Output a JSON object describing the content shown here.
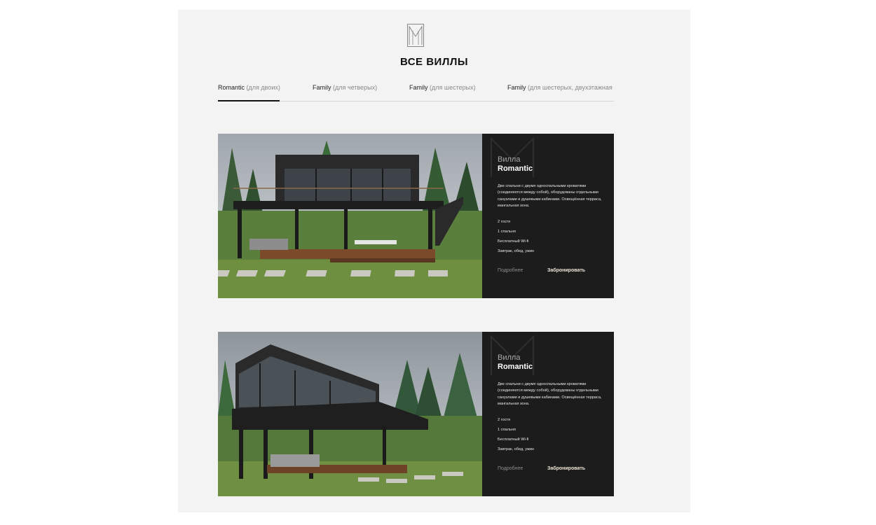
{
  "page_title": "ВСЕ ВИЛЛЫ",
  "logo": {
    "icon": "villa-logo-icon"
  },
  "tabs": [
    {
      "label": "Romantic",
      "sub": "(для двоих)",
      "active": true
    },
    {
      "label": "Family",
      "sub": "(для четверых)",
      "active": false
    },
    {
      "label": "Family",
      "sub": "(для шестерых)",
      "active": false
    },
    {
      "label": "Family",
      "sub": "(для шестерых, двухэтажная",
      "active": false
    }
  ],
  "cards": [
    {
      "villa_label": "Вилла",
      "name": "Romantic",
      "description": "Две спальни с двумя односпальными кроватями (соединяются между собой), оборудованы отдельными санузлами и душевыми кабинами. Освещённая терраса, мангальная зона.",
      "features": [
        "2 гостя",
        "1 спальня",
        "Бесплатный Wi-fi",
        "Завтрак, обед, ужин"
      ],
      "more_label": "Подробнее",
      "book_label": "Забронировать"
    },
    {
      "villa_label": "Вилла",
      "name": "Romantic",
      "description": "Две спальни с двумя односпальными кроватями (соединяются между собой), оборудованы отдельными санузлами и душевыми кабинами. Освещённая терраса, мангальная зона.",
      "features": [
        "2 гостя",
        "1 спальня",
        "Бесплатный Wi-fi",
        "Завтрак, обед, ужин"
      ],
      "more_label": "Подробнее",
      "book_label": "Забронировать"
    }
  ],
  "colors": {
    "panel": "#1c1c1c",
    "page_bg": "#f3f3f3",
    "accent": "#f0e6d8"
  }
}
